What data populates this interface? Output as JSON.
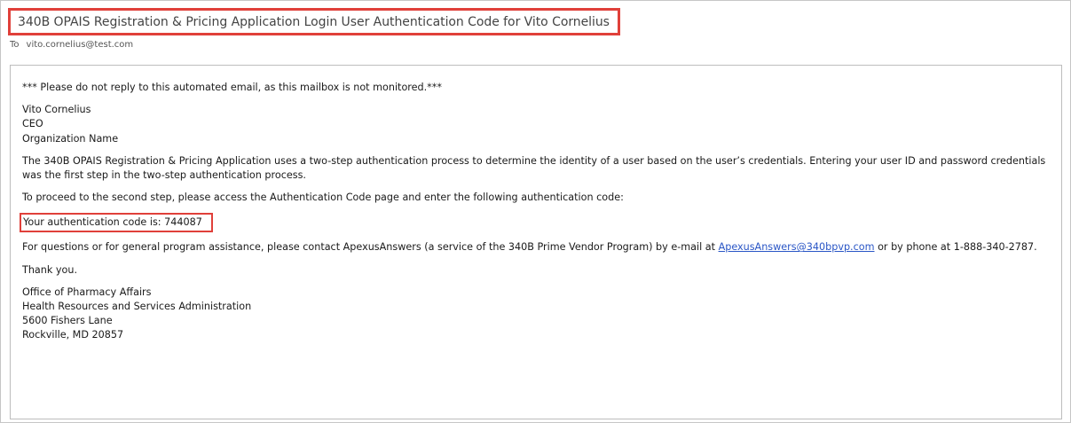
{
  "email": {
    "subject": "340B OPAIS Registration & Pricing Application Login User Authentication Code for Vito Cornelius",
    "to_label": "To",
    "to_address": "vito.cornelius@test.com"
  },
  "body": {
    "notice": "*** Please do not reply to this automated email, as this mailbox is not monitored.***",
    "recipient_name": "Vito Cornelius",
    "recipient_title": "CEO",
    "recipient_org": "Organization Name",
    "intro_paragraph": "The 340B OPAIS Registration & Pricing Application uses a two-step authentication process to determine the identity of a user based on the user’s credentials. Entering your user ID and password credentials was the first step in the two-step authentication process.",
    "instruction": "To proceed to the second step, please access the Authentication Code page and enter the following authentication code:",
    "code_label": "Your authentication code is: 744087",
    "contact_prefix": "For questions or for general program assistance, please contact ApexusAnswers (a service of the 340B Prime Vendor Program) by e-mail at",
    "contact_email": "ApexusAnswers@340bpvp.com",
    "contact_suffix": "or by phone at 1-888-340-2787.",
    "thanks": "Thank you.",
    "signature": [
      "Office of Pharmacy Affairs",
      "Health Resources and Services Administration",
      "5600 Fishers Lane",
      "Rockville, MD  20857"
    ]
  },
  "colors": {
    "highlight_border": "#e0403a",
    "link": "#2a56c6"
  }
}
